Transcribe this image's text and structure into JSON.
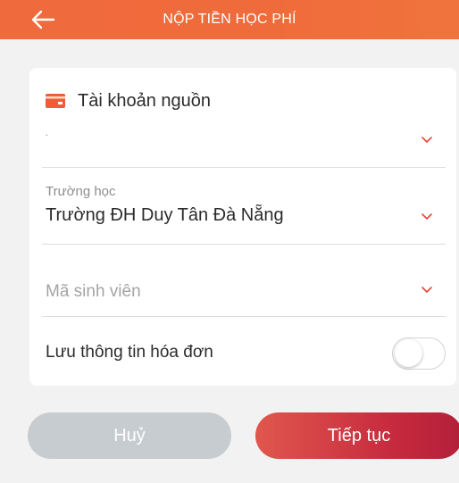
{
  "header": {
    "title": "NỘP TIỀN HỌC PHÍ",
    "back_icon": "arrow-left-icon",
    "color": "#ef6a3c"
  },
  "form": {
    "source_account": {
      "title": "Tài khoản nguồn",
      "icon": "card-icon",
      "value": "."
    },
    "school": {
      "label": "Trường học",
      "value": "Trường ĐH Duy Tân Đà Nẵng"
    },
    "student_id": {
      "placeholder": "Mã sinh viên"
    },
    "save_invoice": {
      "label": "Lưu thông tin hóa đơn",
      "enabled": false
    }
  },
  "buttons": {
    "cancel_label": "Huỷ",
    "next_label": "Tiếp tục"
  },
  "colors": {
    "accent": "#e8443d",
    "primary_button": "#c5283d",
    "disabled_button": "#c7ccd0"
  }
}
